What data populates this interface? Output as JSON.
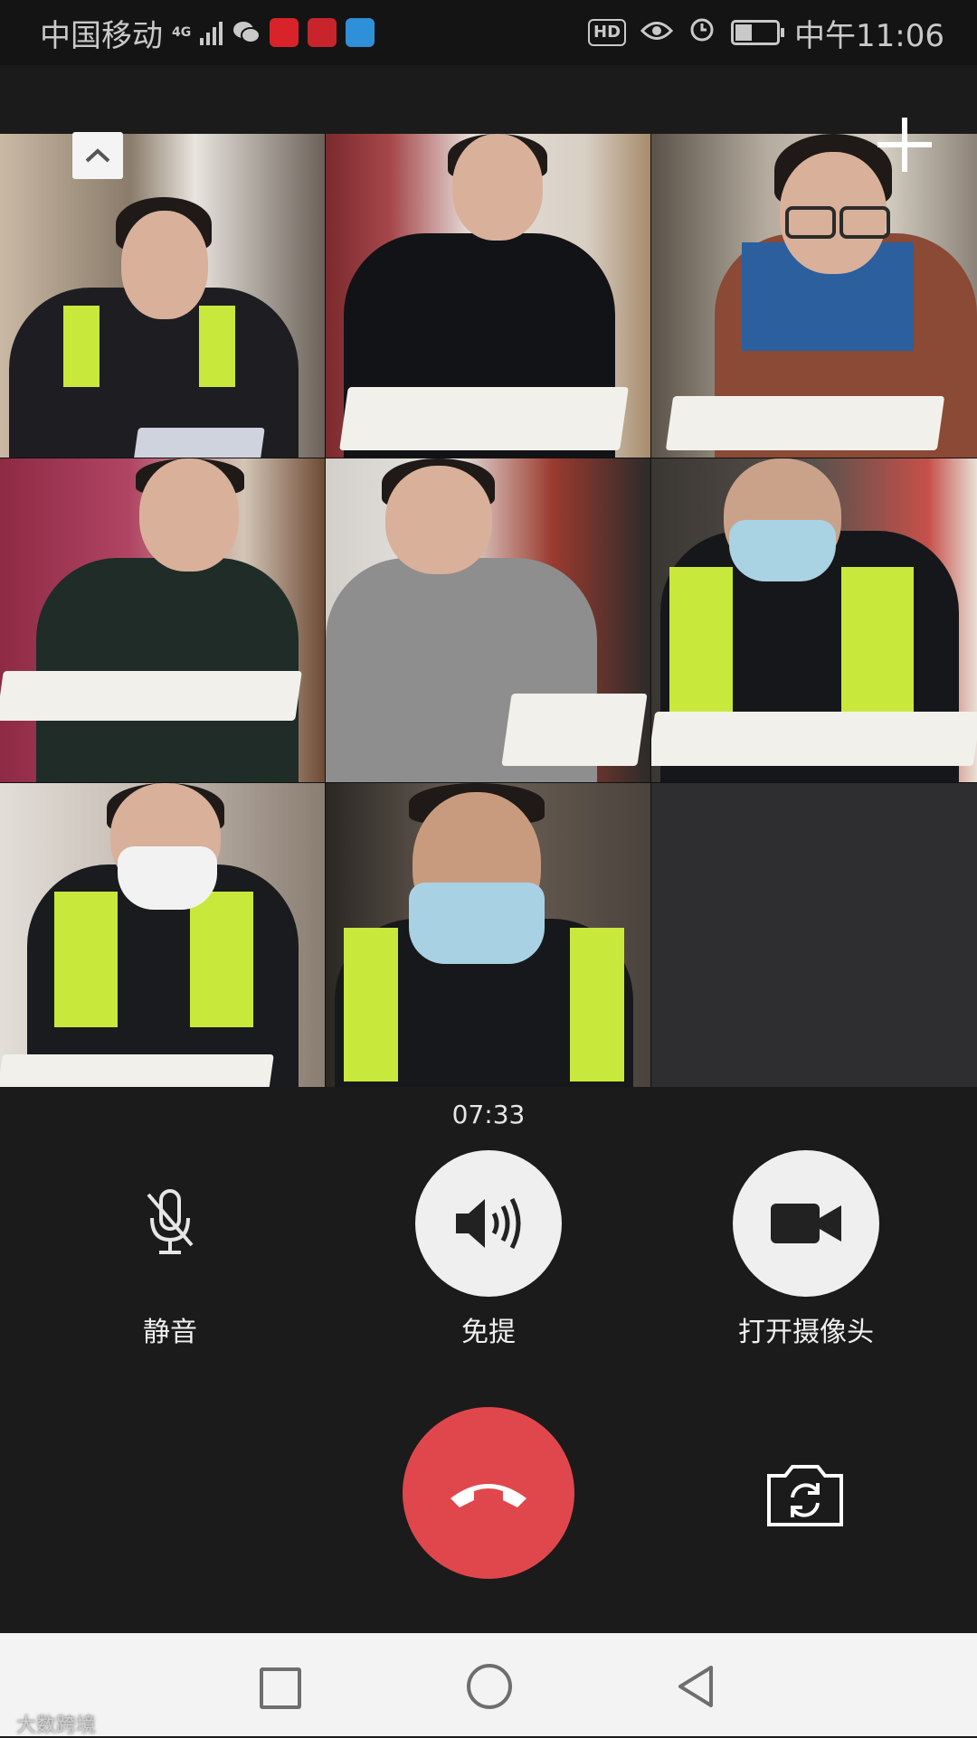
{
  "status_bar": {
    "carrier": "中国移动",
    "network": "4G",
    "hd_badge": "HD",
    "time": "中午11:06"
  },
  "call": {
    "timer": "07:33",
    "participant_count": 8,
    "controls": {
      "mute_label": "静音",
      "speaker_label": "免提",
      "camera_label": "打开摄像头"
    }
  },
  "icons": {
    "collapse": "chevron-up-icon",
    "add_member": "plus-icon",
    "mute": "microphone-muted-icon",
    "speaker": "speaker-icon",
    "camera": "video-camera-icon",
    "hangup": "phone-hangup-icon",
    "flip_camera": "switch-camera-icon"
  },
  "colors": {
    "hangup_red": "#e0474c",
    "call_background": "#1b1b1b",
    "control_circle": "#efefef",
    "vest_green": "#c9e83c"
  },
  "watermark": "大数跨境"
}
